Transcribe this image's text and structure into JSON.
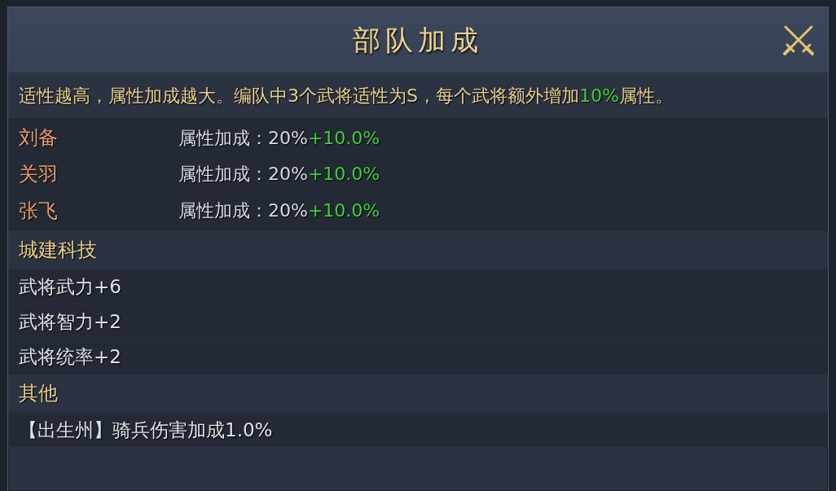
{
  "window": {
    "title": "部队加成"
  },
  "description": [
    {
      "text": "适性越高，属性加成越大。编队中3个武将适性为S，每个武将额外增加",
      "highlight": false
    },
    {
      "text": "10%",
      "highlight": true
    },
    {
      "text": "属性。",
      "highlight": false
    }
  ],
  "generals": [
    {
      "name": "刘备",
      "stat": "属性加成：20%",
      "bonus": "+10.0%"
    },
    {
      "name": "关羽",
      "stat": "属性加成：20%",
      "bonus": "+10.0%"
    },
    {
      "name": "张飞",
      "stat": "属性加成：20%",
      "bonus": "+10.0%"
    }
  ],
  "sections": [
    {
      "title": "城建科技",
      "items": [
        "武将武力+6",
        "武将智力+2",
        "武将统率+2"
      ]
    },
    {
      "title": "其他",
      "items": [
        "【出生州】骑兵伤害加成1.0%"
      ]
    }
  ]
}
